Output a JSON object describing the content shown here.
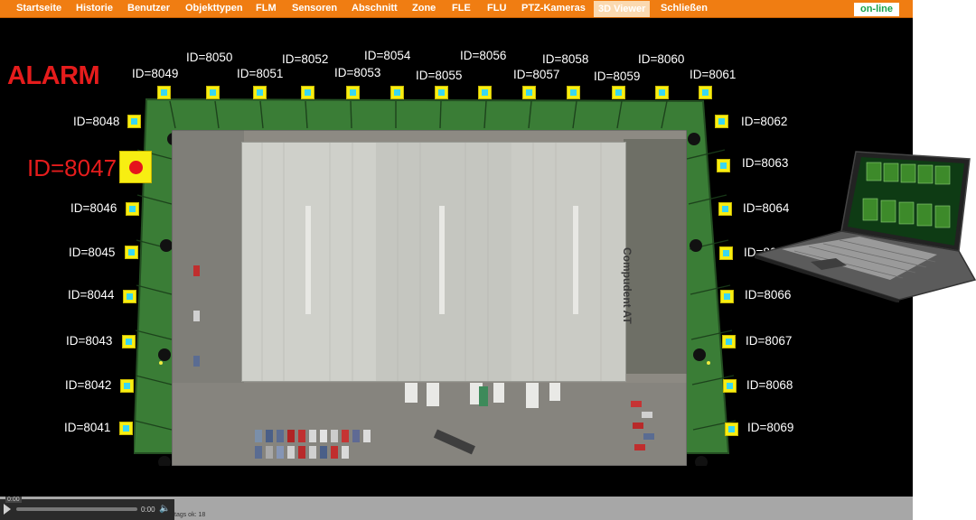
{
  "nav": {
    "items": [
      {
        "label": "Startseite"
      },
      {
        "label": "Historie"
      },
      {
        "label": "Benutzer"
      },
      {
        "label": "Objekttypen"
      },
      {
        "label": "FLM"
      },
      {
        "label": "Sensoren"
      },
      {
        "label": "Abschnitt"
      },
      {
        "label": "Zone"
      },
      {
        "label": "FLE"
      },
      {
        "label": "FLU"
      },
      {
        "label": "PTZ-Kameras"
      },
      {
        "label": "3D Viewer",
        "active": true
      },
      {
        "label": "Schließen"
      }
    ],
    "status": "on-line"
  },
  "alarm_heading": "ALARM",
  "alarm_sensor": "ID=8047",
  "sensors": {
    "top": [
      "ID=8049",
      "ID=8050",
      "ID=8051",
      "ID=8052",
      "ID=8053",
      "ID=8054",
      "ID=8055",
      "ID=8056",
      "ID=8057",
      "ID=8058",
      "ID=8059",
      "ID=8060",
      "ID=8061"
    ],
    "left": [
      "ID=8048",
      "ID=8046",
      "ID=8045",
      "ID=8044",
      "ID=8043",
      "ID=8042",
      "ID=8041"
    ],
    "right": [
      "ID=8062",
      "ID=8063",
      "ID=8064",
      "ID=8065",
      "ID=8066",
      "ID=8067",
      "ID=8068",
      "ID=8069"
    ]
  },
  "aerial": {
    "sign_text": "Compudent AT"
  },
  "player": {
    "time_chip": "0:00",
    "time": "0:00",
    "progress": 0.0
  },
  "status_text": "tags ok: 18",
  "colors": {
    "nav": "#f07d12",
    "alarm": "#e51c1c",
    "sensor": "#f7ee12",
    "sensor_inner": "#39d7f2",
    "fence": "#2f6b2f",
    "online": "#19a34a"
  }
}
